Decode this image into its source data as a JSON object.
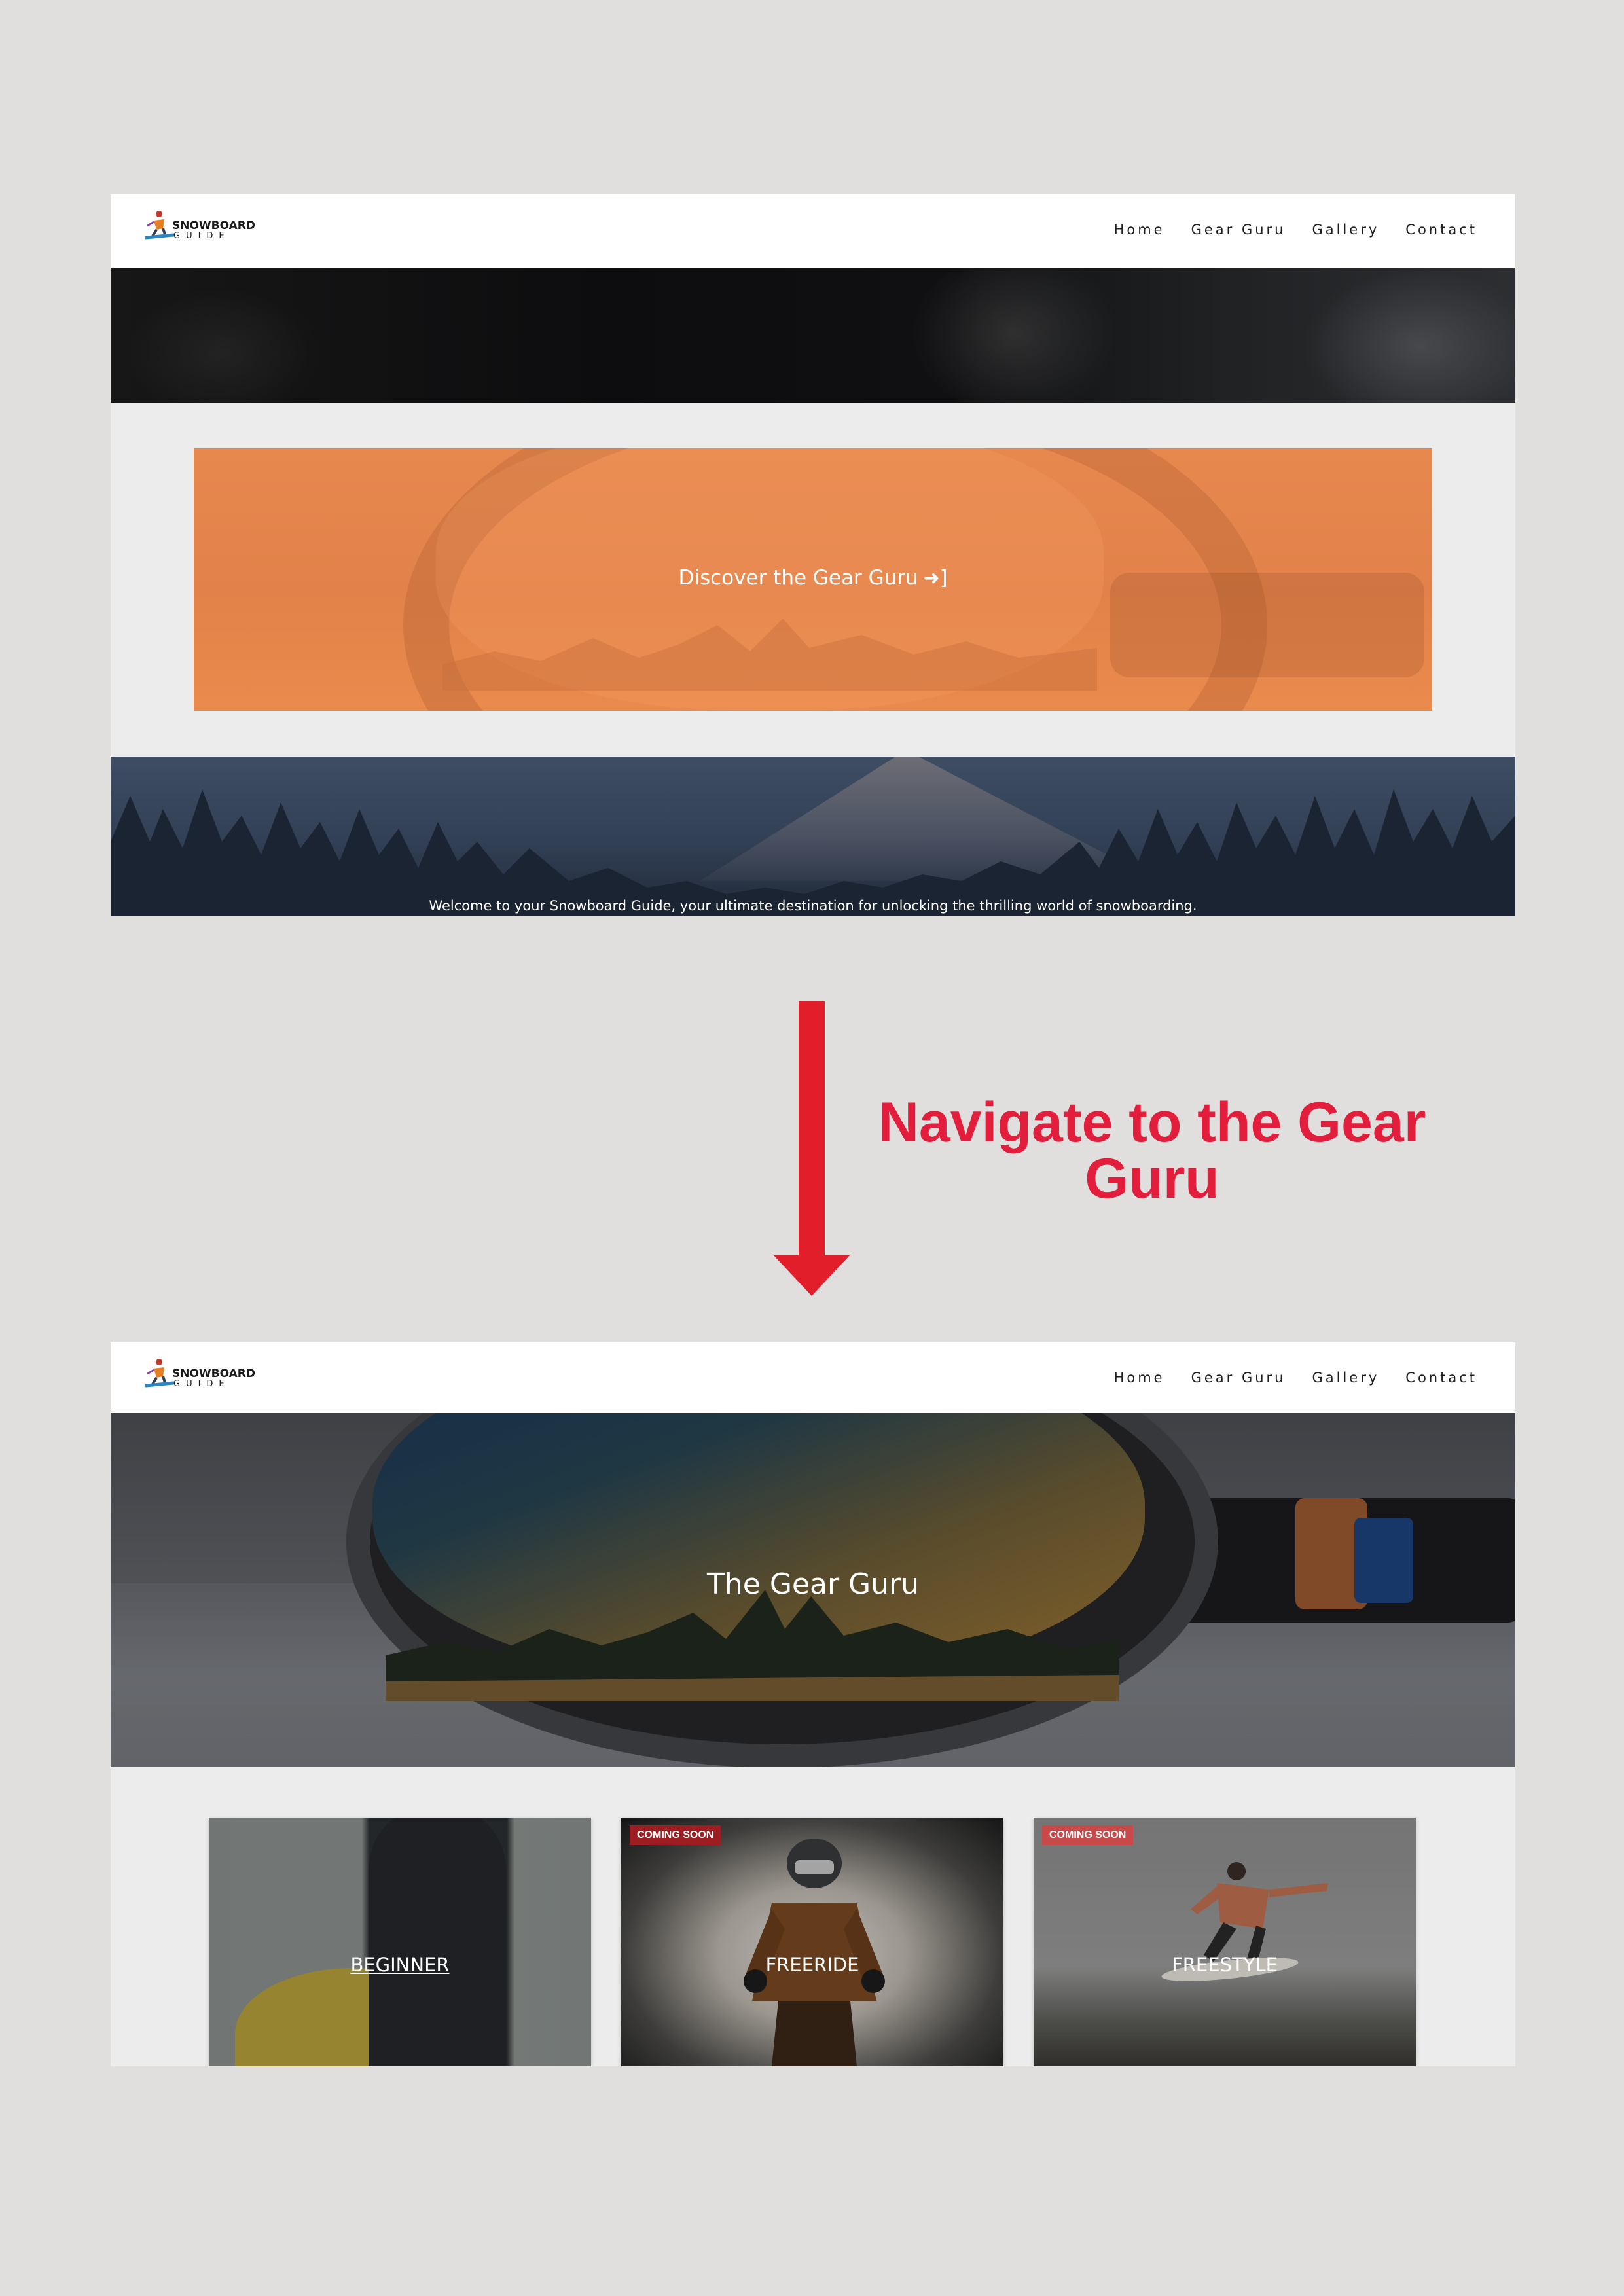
{
  "brand": {
    "logo_top": "SNOWBOARD",
    "logo_bottom": "GUIDE"
  },
  "nav": {
    "items": [
      "Home",
      "Gear Guru",
      "Gallery",
      "Contact"
    ]
  },
  "top_screen": {
    "cta_label": "Discover the Gear Guru",
    "cta_icon": "sign-in-arrow-icon",
    "welcome_text": "Welcome to your Snowboard Guide, your ultimate destination for unlocking the thrilling world of snowboarding."
  },
  "transition": {
    "caption_line1": "Navigate to the Gear",
    "caption_line2": "Guru",
    "arrow_color": "#e21e2a",
    "caption_color": "#e21e3c"
  },
  "bottom_screen": {
    "hero_title": "The Gear Guru",
    "cards": [
      {
        "label": "BEGINNER",
        "badge": ""
      },
      {
        "label": "FREERIDE",
        "badge": "COMING SOON"
      },
      {
        "label": "FREESTYLE",
        "badge": "COMING SOON"
      }
    ]
  },
  "colors": {
    "cta_orange": "#e2824a",
    "badge_red": "#9e1d22",
    "page_background": "#e0dfdd"
  }
}
